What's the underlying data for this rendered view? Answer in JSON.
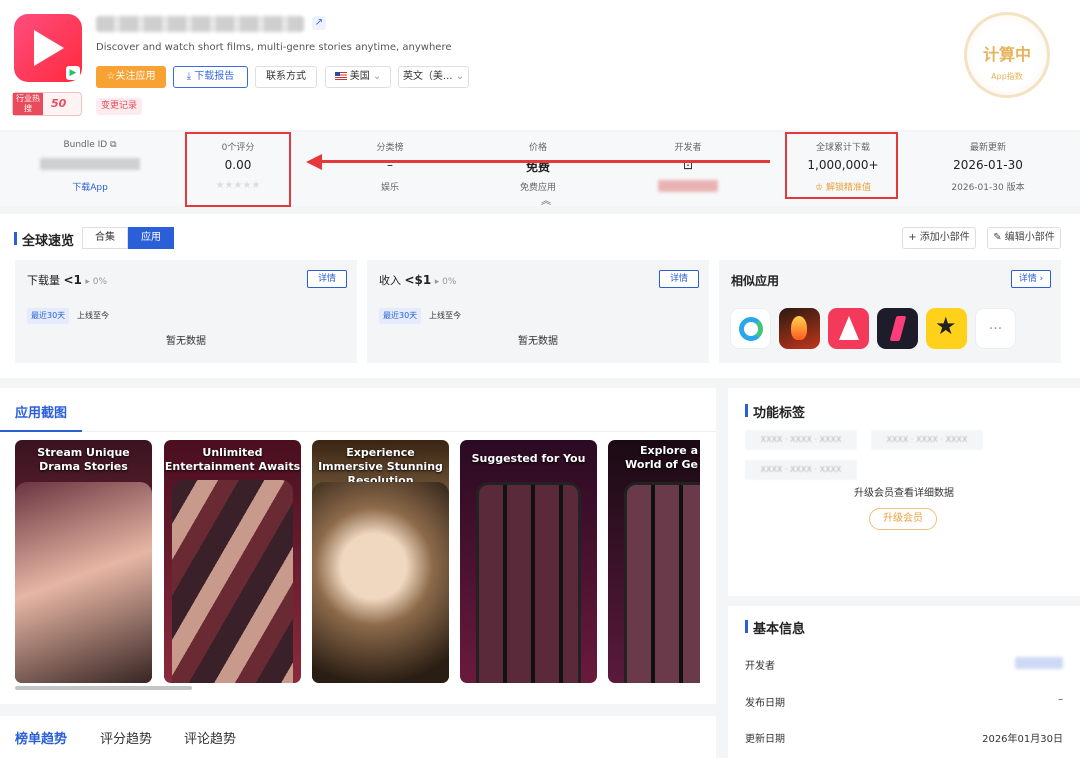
{
  "app": {
    "subtitle": "Discover and watch short films, multi-genre stories anytime, anywhere",
    "hot_badge_label": "行业热搜",
    "hot_badge_value": "50",
    "changelog": "变更记录"
  },
  "actions": {
    "follow": "☆关注应用",
    "report": "⤓ 下载报告",
    "contact": "联系方式",
    "country": "美国",
    "language": "英文（美..."
  },
  "seal": {
    "main": "计算中",
    "sub": "App指数"
  },
  "stats": {
    "bundle": {
      "label": "Bundle ID",
      "link": "下载App"
    },
    "rating": {
      "label": "0个评分",
      "value": "0.00",
      "stars": "★★★★★"
    },
    "category": {
      "label": "分类榜",
      "value": "–",
      "sub": "娱乐"
    },
    "price": {
      "label": "价格",
      "value": "免费",
      "sub": "免费应用"
    },
    "developer": {
      "label": "开发者"
    },
    "downloads": {
      "label": "全球累计下载",
      "value": "1,000,000+",
      "sub": "解锁精准值"
    },
    "updated": {
      "label": "最新更新",
      "value": "2026-01-30",
      "sub": "2026-01-30 版本"
    },
    "expand": "︽"
  },
  "overview": {
    "title": "全球速览",
    "tabs": [
      "合集",
      "应用"
    ],
    "active_tab": 1,
    "add_widget": "+ 添加小部件",
    "edit_widget": "编辑小部件",
    "downloads": {
      "label": "下载量",
      "value": "<1",
      "pct": "▸ 0%",
      "detail": "详情",
      "range_active": "最近30天",
      "range_other": "上线至今",
      "empty": "暂无数据"
    },
    "revenue": {
      "label": "收入",
      "value": "<$1",
      "pct": "▸ 0%",
      "detail": "详情",
      "range_active": "最近30天",
      "range_other": "上线至今",
      "empty": "暂无数据"
    },
    "similar": {
      "title": "相似应用",
      "detail": "详情 ›",
      "more": "···"
    }
  },
  "screenshots": {
    "title": "应用截图",
    "items": [
      {
        "caption": "Stream Unique Drama Stories"
      },
      {
        "caption": "Unlimited Entertainment Awaits"
      },
      {
        "caption": "Experience Immersive Stunning Resolution"
      },
      {
        "caption": "Suggested for You"
      },
      {
        "caption": "Explore a World of Ge"
      }
    ]
  },
  "features": {
    "title": "功能标签",
    "tags": [
      "XXXX · XXXX · XXXX",
      "XXXX · XXXX · XXXX",
      "XXXX · XXXX · XXXX"
    ],
    "upgrade_text": "升级会员查看详细数据",
    "upgrade_button": "升级会员"
  },
  "basic_info": {
    "title": "基本信息",
    "rows": [
      {
        "label": "开发者",
        "value": ""
      },
      {
        "label": "发布日期",
        "value": "–"
      },
      {
        "label": "更新日期",
        "value": "2026年01月30日"
      }
    ]
  },
  "trends": {
    "tabs": [
      "榜单趋势",
      "评分趋势",
      "评论趋势"
    ]
  },
  "colors": {
    "accent": "#2a5fd8",
    "highlight": "#e5383b",
    "orange": "#f8a233"
  }
}
